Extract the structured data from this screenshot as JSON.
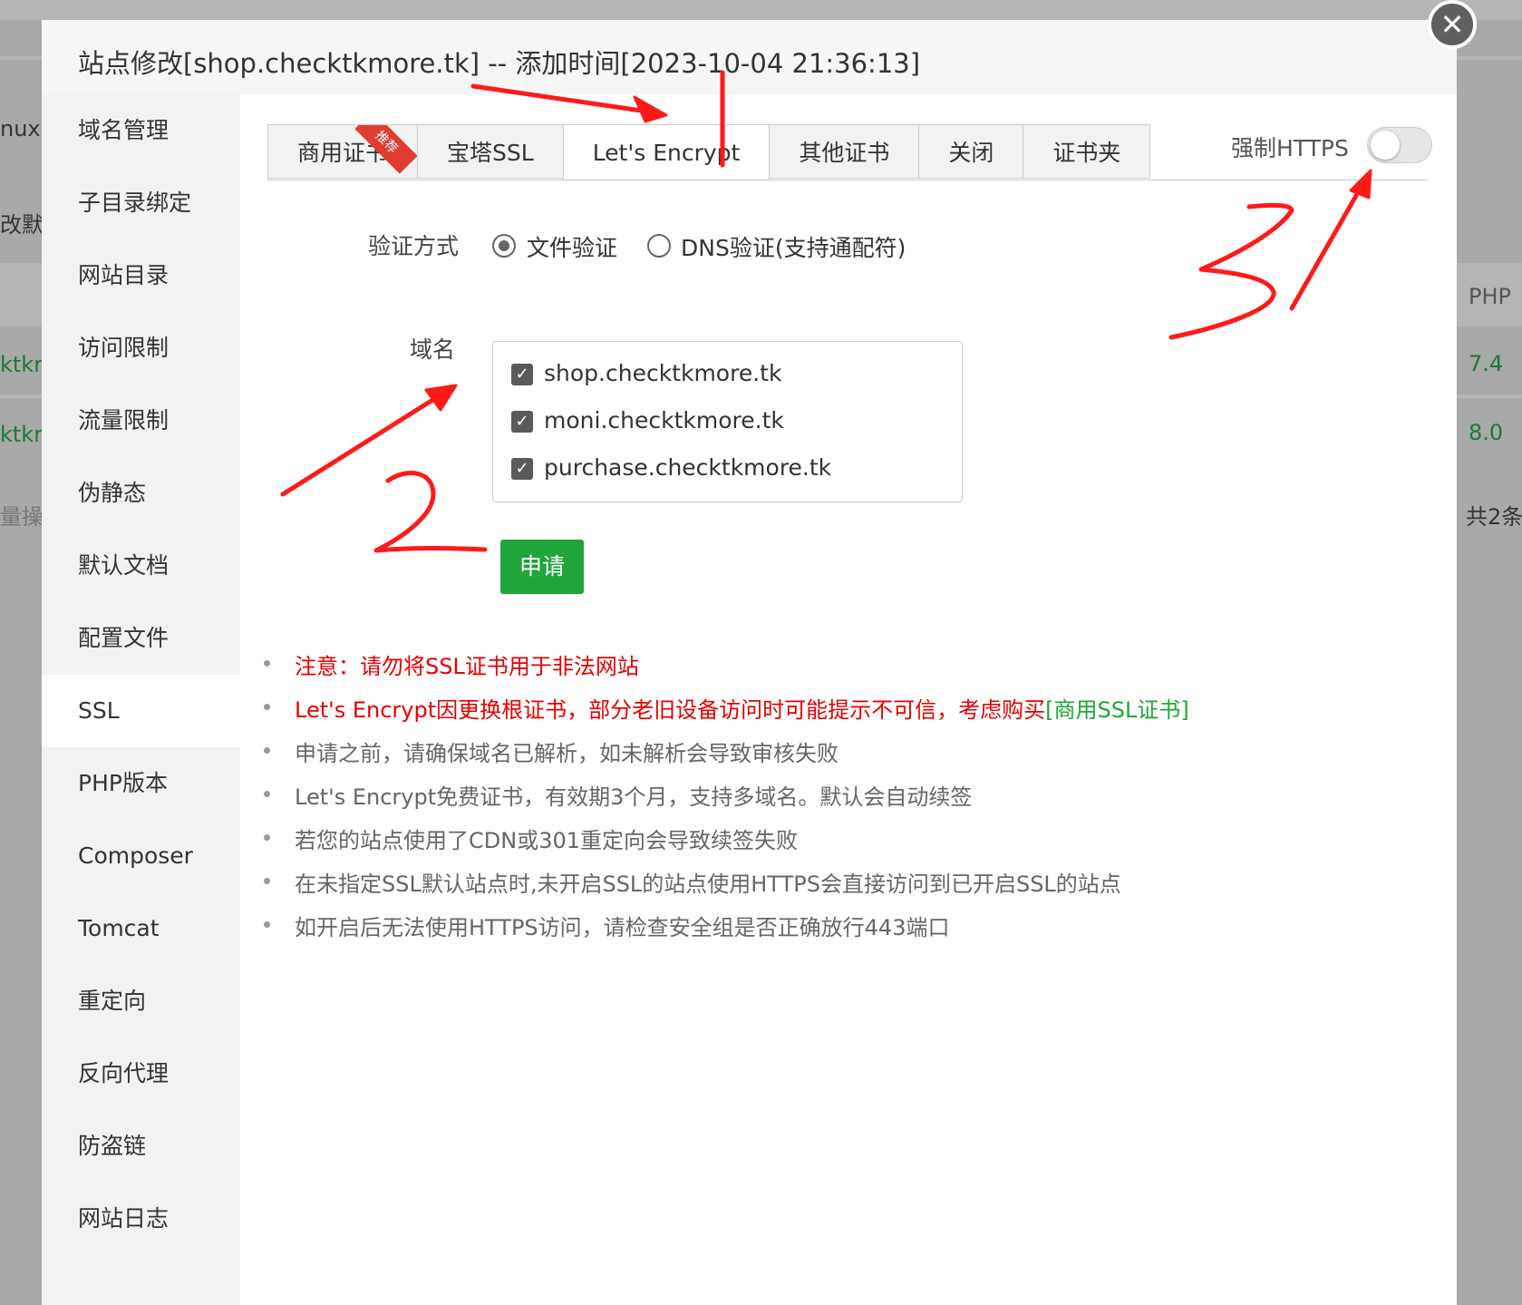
{
  "background": {
    "fragments": [
      "nux面",
      "改默",
      "ktkr",
      "ktkr",
      "量操作",
      "PHP",
      "7.4",
      "8.0",
      "共2条"
    ]
  },
  "modal": {
    "title": "站点修改[shop.checktkmore.tk] -- 添加时间[2023-10-04 21:36:13]",
    "close_icon": "close-icon"
  },
  "sidebar": {
    "items": [
      {
        "label": "域名管理"
      },
      {
        "label": "子目录绑定"
      },
      {
        "label": "网站目录"
      },
      {
        "label": "访问限制"
      },
      {
        "label": "流量限制"
      },
      {
        "label": "伪静态"
      },
      {
        "label": "默认文档"
      },
      {
        "label": "配置文件"
      },
      {
        "label": "SSL"
      },
      {
        "label": "PHP版本"
      },
      {
        "label": "Composer"
      },
      {
        "label": "Tomcat"
      },
      {
        "label": "重定向"
      },
      {
        "label": "反向代理"
      },
      {
        "label": "防盗链"
      },
      {
        "label": "网站日志"
      }
    ],
    "active": "SSL"
  },
  "tabs": {
    "items": [
      {
        "label": "商用证书"
      },
      {
        "label": "宝塔SSL"
      },
      {
        "label": "Let's Encrypt"
      },
      {
        "label": "其他证书"
      },
      {
        "label": "关闭"
      },
      {
        "label": "证书夹"
      }
    ],
    "active": "Let's Encrypt",
    "recommend_ribbon": "推荐"
  },
  "force_https": {
    "label": "强制HTTPS",
    "enabled": false
  },
  "verify": {
    "label": "验证方式",
    "options": [
      {
        "label": "文件验证",
        "checked": true
      },
      {
        "label": "DNS验证(支持通配符)",
        "checked": false
      }
    ]
  },
  "domains": {
    "label": "域名",
    "items": [
      {
        "name": "shop.checktkmore.tk",
        "checked": true
      },
      {
        "name": "moni.checktkmore.tk",
        "checked": true
      },
      {
        "name": "purchase.checktkmore.tk",
        "checked": true
      }
    ],
    "check_glyph": "✓"
  },
  "apply_button": {
    "label": "申请"
  },
  "notes": [
    {
      "text": "注意：请勿将SSL证书用于非法网站"
    },
    {
      "text": "Let's Encrypt因更换根证书，部分老旧设备访问时可能提示不可信，考虑购买",
      "link": "[商用SSL证书]"
    },
    {
      "text": "申请之前，请确保域名已解析，如未解析会导致审核失败"
    },
    {
      "text": "Let's Encrypt免费证书，有效期3个月，支持多域名。默认会自动续签"
    },
    {
      "text": "若您的站点使用了CDN或301重定向会导致续签失败"
    },
    {
      "text": "在未指定SSL默认站点时,未开启SSL的站点使用HTTPS会直接访问到已开启SSL的站点"
    },
    {
      "text": "如开启后无法使用HTTPS访问，请检查安全组是否正确放行443端口"
    }
  ],
  "colors": {
    "accent_green": "#20a53a",
    "warning_red": "#e60000",
    "annotation_red": "#ff1a1a"
  }
}
